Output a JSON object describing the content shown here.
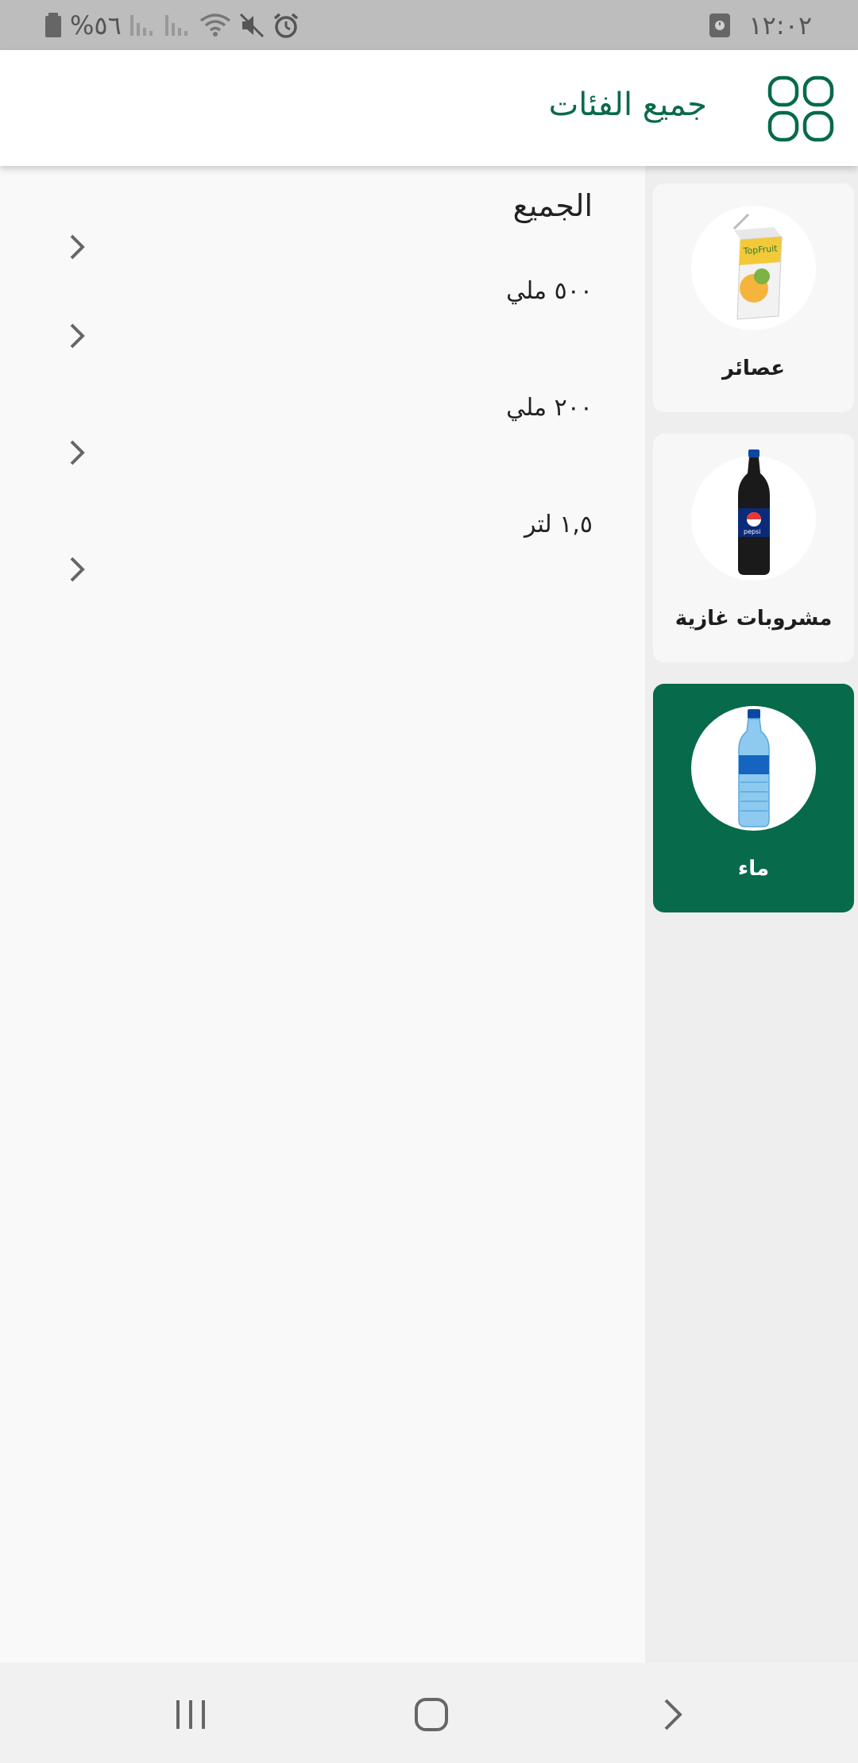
{
  "status_bar": {
    "time": "١٢:٠٢",
    "battery": "%٥٦"
  },
  "app_bar": {
    "title": "جميع الفئات"
  },
  "categories": [
    {
      "label": "عصائر",
      "icon": "juice-carton",
      "active": false
    },
    {
      "label": "مشروبات غازية",
      "icon": "soda-bottle",
      "active": false
    },
    {
      "label": "ماء",
      "icon": "water-bottle",
      "active": true
    }
  ],
  "subcategories": [
    {
      "label": "الجميع"
    },
    {
      "label": "٥٠٠ ملي"
    },
    {
      "label": "٢٠٠ ملي"
    },
    {
      "label": "١,٥ لتر"
    }
  ],
  "colors": {
    "primary": "#066a4b",
    "status_bar": "#bdbdbd",
    "sidebar": "#eeeeee",
    "background": "#f9f9f9"
  }
}
